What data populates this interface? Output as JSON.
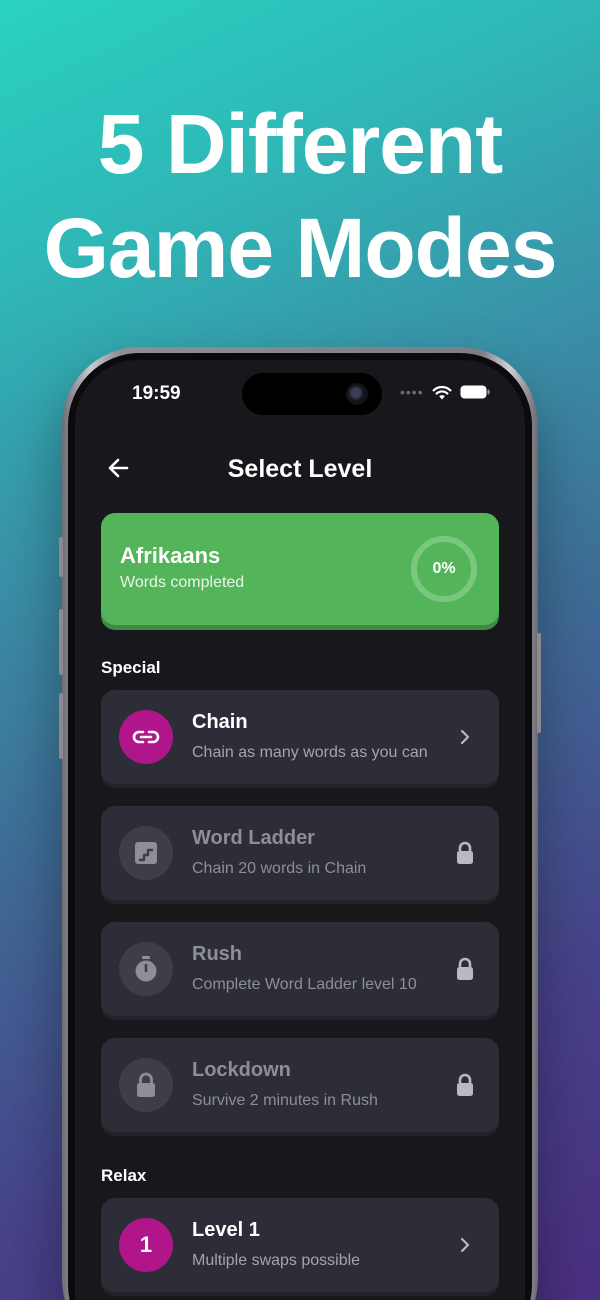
{
  "headline": {
    "line1": "5 Different",
    "line2": "Game Modes"
  },
  "status_bar": {
    "time": "19:59",
    "icons": [
      "cellular-dots-icon",
      "wifi-icon",
      "battery-icon"
    ]
  },
  "nav": {
    "title": "Select Level",
    "back_icon": "arrow-left-icon"
  },
  "language_card": {
    "name": "Afrikaans",
    "subtitle": "Words completed",
    "progress_label": "0%",
    "progress": 0,
    "color": "#53b45a"
  },
  "sections": {
    "special": {
      "label": "Special",
      "items": [
        {
          "title": "Chain",
          "description": "Chain as many words as you can",
          "icon": "link-icon",
          "state": "unlocked",
          "trailing": "chevron-right-icon"
        },
        {
          "title": "Word Ladder",
          "description": "Chain 20 words in Chain",
          "icon": "stairs-icon",
          "state": "locked",
          "trailing": "lock-icon"
        },
        {
          "title": "Rush",
          "description": "Complete Word Ladder level 10",
          "icon": "stopwatch-icon",
          "state": "locked",
          "trailing": "lock-icon"
        },
        {
          "title": "Lockdown",
          "description": "Survive 2 minutes in Rush",
          "icon": "lock-icon",
          "state": "locked",
          "trailing": "lock-icon"
        }
      ]
    },
    "relax": {
      "label": "Relax",
      "items": [
        {
          "title": "Level 1",
          "description": "Multiple swaps possible",
          "icon_text": "1",
          "state": "unlocked",
          "trailing": "chevron-right-icon"
        }
      ]
    }
  },
  "colors": {
    "accent_magenta": "#b01689",
    "card_bg": "#2c2d36",
    "screen_bg": "#18171c",
    "green": "#53b45a"
  }
}
